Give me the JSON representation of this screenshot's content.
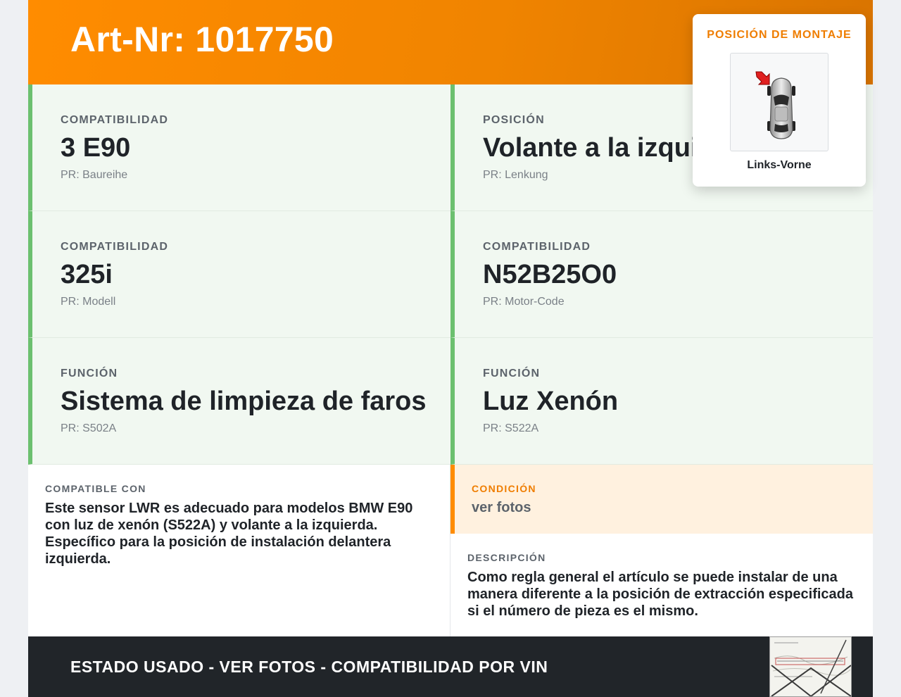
{
  "header": {
    "title": "Art-Nr: 1017750"
  },
  "cells": [
    {
      "label": "COMPATIBILIDAD",
      "value": "3 E90",
      "pr": "PR: Baureihe"
    },
    {
      "label": "POSICIÓN",
      "value": "Volante a la izquierda",
      "pr": "PR: Lenkung"
    },
    {
      "label": "COMPATIBILIDAD",
      "value": "325i",
      "pr": "PR: Modell"
    },
    {
      "label": "COMPATIBILIDAD",
      "value": "N52B25O0",
      "pr": "PR: Motor-Code"
    },
    {
      "label": "FUNCIÓN",
      "value": "Sistema de limpieza de faros",
      "pr": "PR: S502A"
    },
    {
      "label": "FUNCIÓN",
      "value": "Luz Xenón",
      "pr": "PR: S522A"
    }
  ],
  "compatible": {
    "label": "COMPATIBLE CON",
    "text": "Este sensor LWR es adecuado para modelos BMW E90 con luz de xenón (S522A) y volante a la izquierda. Específico para la posición de instalación delantera izquierda."
  },
  "condition": {
    "label": "CONDICIÓN",
    "value": "ver fotos"
  },
  "description": {
    "label": "DESCRIPCIÓN",
    "text": "Como regla general el artículo se puede instalar de una manera diferente a la posición de extracción especificada si el número de pieza es el mismo."
  },
  "footer": {
    "text": "ESTADO USADO - VER FOTOS - COMPATIBILIDAD POR VIN"
  },
  "mounting": {
    "title": "POSICIÓN DE MONTAJE",
    "caption": "Links-Vorne",
    "icon": "car-top-view-arrow-front-left-icon"
  },
  "colors": {
    "accent": "#ff8c00",
    "green_border": "#6cc06f",
    "cell_bg": "#f1f8f1",
    "condition_bg": "#fff1df",
    "footer_bg": "#212529"
  }
}
